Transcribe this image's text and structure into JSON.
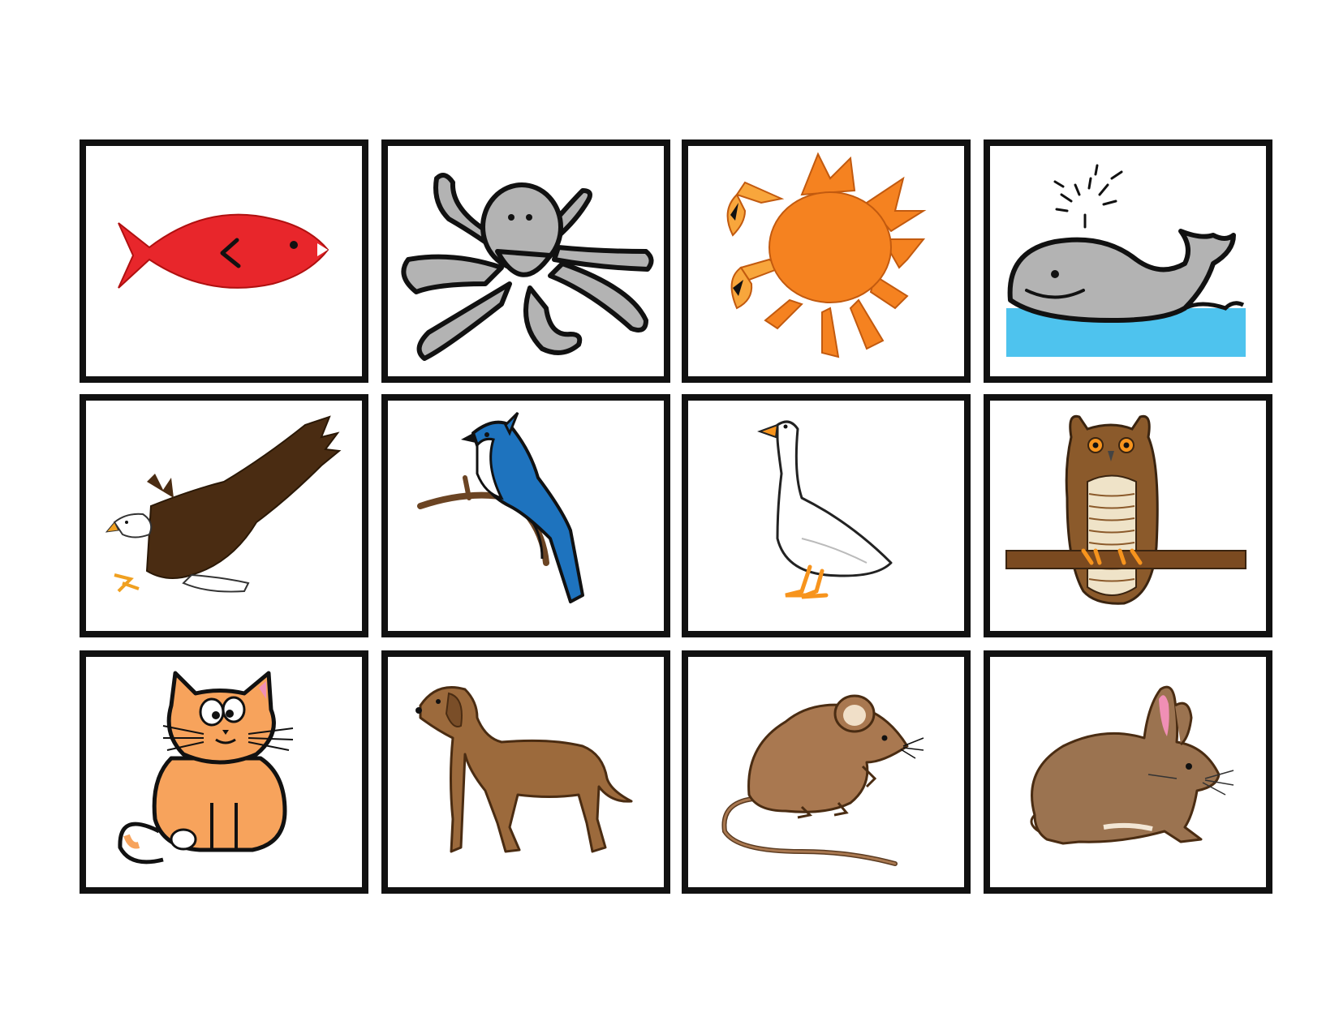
{
  "cards": [
    {
      "icon": "fish-icon"
    },
    {
      "icon": "octopus-icon"
    },
    {
      "icon": "crab-icon"
    },
    {
      "icon": "whale-icon"
    },
    {
      "icon": "eagle-icon"
    },
    {
      "icon": "blue-jay-icon"
    },
    {
      "icon": "goose-icon"
    },
    {
      "icon": "owl-icon"
    },
    {
      "icon": "cat-icon"
    },
    {
      "icon": "dog-icon"
    },
    {
      "icon": "mouse-icon"
    },
    {
      "icon": "rabbit-icon"
    }
  ],
  "colors": {
    "card_border": "#111111",
    "fish": "#e8262b",
    "octopus": "#b3b3b3",
    "crab": "#f58220",
    "whale": "#b3b3b3",
    "water": "#4ec3ee",
    "eagle": "#4a2c12",
    "blue_jay": "#1e73be",
    "goose": "#ffffff",
    "owl": "#8b5a2b",
    "cat": "#f7a35c",
    "dog": "#9c6a3c",
    "mouse": "#a97850",
    "rabbit": "#9b7350"
  }
}
